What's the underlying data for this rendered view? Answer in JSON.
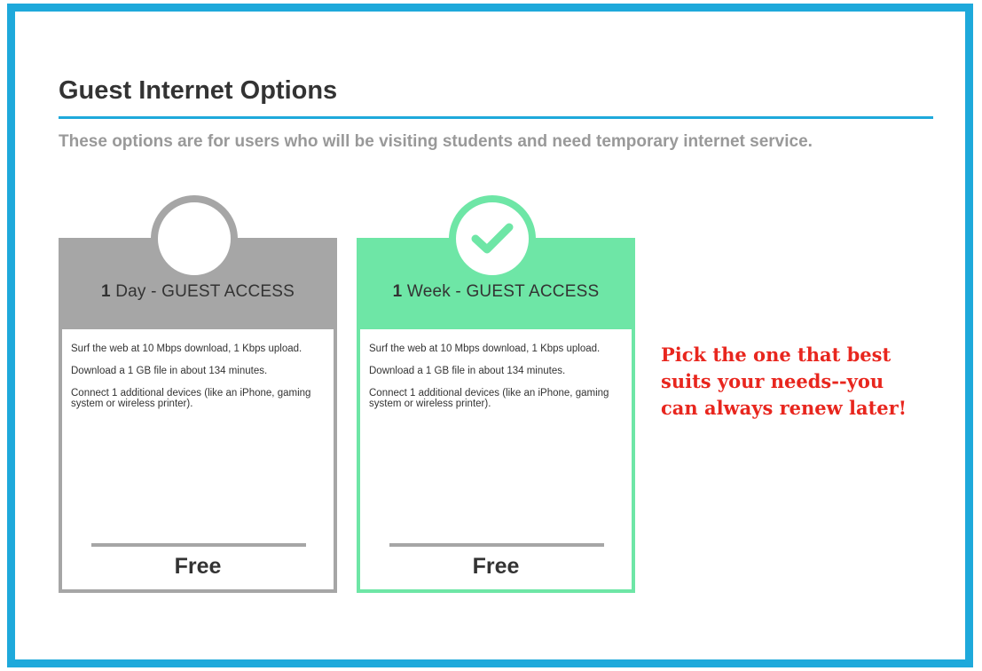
{
  "header": {
    "title": "Guest Internet Options",
    "subtitle": "These options are for users who will be visiting students and need temporary internet service."
  },
  "plans": [
    {
      "title_number": "1",
      "title_rest": " Day - GUEST ACCESS",
      "selected": false,
      "features": [
        "Surf the web at 10 Mbps download, 1 Kbps upload.",
        "Download a 1 GB file in about 134 minutes.",
        "Connect 1 additional devices (like an iPhone, gaming system or wireless printer)."
      ],
      "price": "Free",
      "badge_icon": "empty-circle-icon",
      "accent_color": "#a6a6a6"
    },
    {
      "title_number": "1",
      "title_rest": " Week - GUEST ACCESS",
      "selected": true,
      "features": [
        "Surf the web at 10 Mbps download, 1 Kbps upload.",
        "Download a 1 GB file in about 134 minutes.",
        "Connect 1 additional devices (like an iPhone, gaming system or wireless printer)."
      ],
      "price": "Free",
      "badge_icon": "checkmark-icon",
      "accent_color": "#6ee6a6"
    }
  ],
  "note": {
    "text": "Pick the one that best suits your needs--you can always renew later!",
    "color": "#e8261e"
  },
  "colors": {
    "frame_border": "#1ea9db",
    "title_rule": "#1ea9db",
    "subtitle_text": "#999999"
  }
}
